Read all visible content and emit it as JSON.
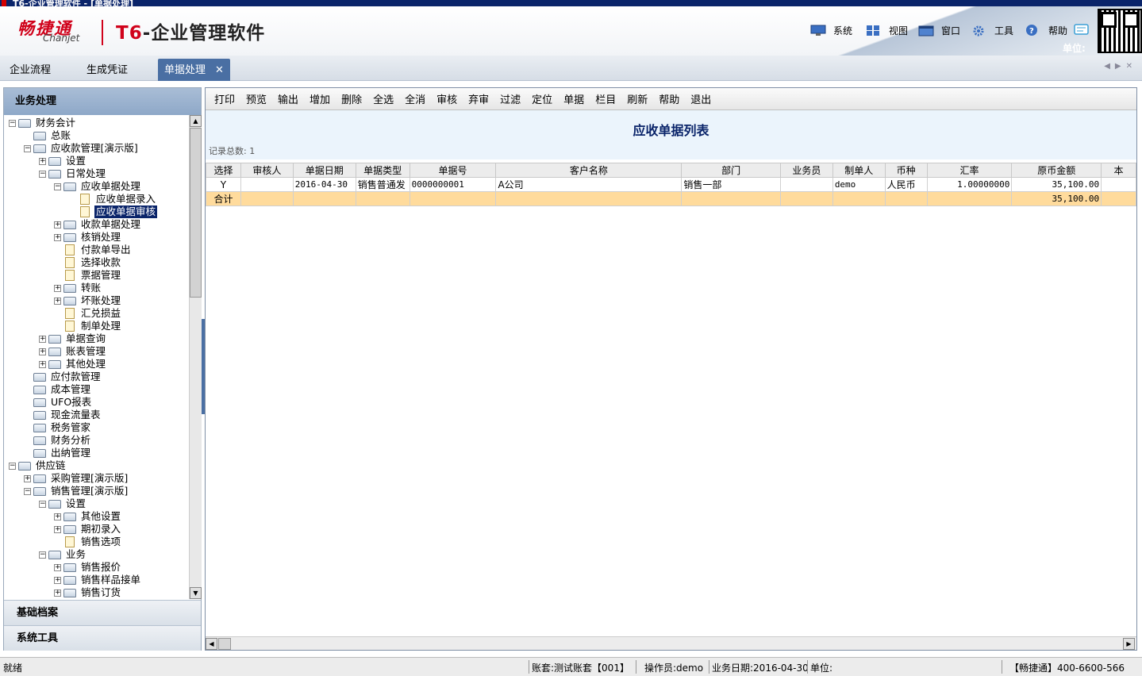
{
  "window": {
    "title": "T6-企业管理软件 - [单据处理]"
  },
  "header": {
    "logo_cn": "畅捷通",
    "logo_en": "Chanjet",
    "product_prefix": "T6",
    "product_name": "-企业管理软件",
    "menus": [
      {
        "label": "系统",
        "icon": "monitor-icon"
      },
      {
        "label": "视图",
        "icon": "grid-view-icon"
      },
      {
        "label": "窗口",
        "icon": "window-icon"
      },
      {
        "label": "工具",
        "icon": "gear-icon"
      },
      {
        "label": "帮助",
        "icon": "help-icon"
      }
    ],
    "unit_label": "单位:",
    "brand_red": "#d0021b"
  },
  "tabs": [
    {
      "label": "企业流程"
    },
    {
      "label": "生成凭证"
    },
    {
      "label": "单据处理",
      "active": true
    }
  ],
  "sidebar": {
    "title": "业务处理",
    "tree": [
      {
        "label": "财务会计",
        "type": "folder",
        "expander": "−"
      },
      {
        "label": "总账",
        "type": "folder",
        "expander": ""
      },
      {
        "label": "应收款管理[演示版]",
        "type": "folder",
        "expander": "−"
      },
      {
        "label": "设置",
        "type": "folder",
        "expander": "+"
      },
      {
        "label": "日常处理",
        "type": "folder",
        "expander": "−"
      },
      {
        "label": "应收单据处理",
        "type": "folder",
        "expander": "−"
      },
      {
        "label": "应收单据录入",
        "type": "doc",
        "expander": ""
      },
      {
        "label": "应收单据审核",
        "type": "doc",
        "expander": "",
        "selected": true
      },
      {
        "label": "收款单据处理",
        "type": "folder",
        "expander": "+"
      },
      {
        "label": "核销处理",
        "type": "folder",
        "expander": "+"
      },
      {
        "label": "付款单导出",
        "type": "doc",
        "expander": ""
      },
      {
        "label": "选择收款",
        "type": "doc",
        "expander": ""
      },
      {
        "label": "票据管理",
        "type": "doc",
        "expander": ""
      },
      {
        "label": "转账",
        "type": "folder",
        "expander": "+"
      },
      {
        "label": "坏账处理",
        "type": "folder",
        "expander": "+"
      },
      {
        "label": "汇兑损益",
        "type": "doc",
        "expander": ""
      },
      {
        "label": "制单处理",
        "type": "doc",
        "expander": ""
      },
      {
        "label": "单据查询",
        "type": "folder",
        "expander": "+"
      },
      {
        "label": "账表管理",
        "type": "folder",
        "expander": "+"
      },
      {
        "label": "其他处理",
        "type": "folder",
        "expander": "+"
      },
      {
        "label": "应付款管理",
        "type": "folder",
        "expander": ""
      },
      {
        "label": "成本管理",
        "type": "folder",
        "expander": ""
      },
      {
        "label": "UFO报表",
        "type": "folder",
        "expander": ""
      },
      {
        "label": "现金流量表",
        "type": "folder",
        "expander": ""
      },
      {
        "label": "税务管家",
        "type": "folder",
        "expander": ""
      },
      {
        "label": "财务分析",
        "type": "folder",
        "expander": ""
      },
      {
        "label": "出纳管理",
        "type": "folder",
        "expander": ""
      },
      {
        "label": "供应链",
        "type": "folder",
        "expander": "−"
      },
      {
        "label": "采购管理[演示版]",
        "type": "folder",
        "expander": "+"
      },
      {
        "label": "销售管理[演示版]",
        "type": "folder",
        "expander": "−"
      },
      {
        "label": "设置",
        "type": "folder",
        "expander": "−"
      },
      {
        "label": "其他设置",
        "type": "folder",
        "expander": "+"
      },
      {
        "label": "期初录入",
        "type": "folder",
        "expander": "+"
      },
      {
        "label": "销售选项",
        "type": "doc",
        "expander": ""
      },
      {
        "label": "业务",
        "type": "folder",
        "expander": "−"
      },
      {
        "label": "销售报价",
        "type": "folder",
        "expander": "+"
      },
      {
        "label": "销售样品接单",
        "type": "folder",
        "expander": "+"
      },
      {
        "label": "销售订货",
        "type": "folder",
        "expander": "+"
      }
    ],
    "sections": [
      {
        "label": "基础档案"
      },
      {
        "label": "系统工具"
      }
    ]
  },
  "toolbar": {
    "buttons": [
      "打印",
      "预览",
      "输出",
      "增加",
      "删除",
      "全选",
      "全消",
      "审核",
      "弃审",
      "过滤",
      "定位",
      "单据",
      "栏目",
      "刷新",
      "帮助",
      "退出"
    ]
  },
  "page": {
    "title": "应收单据列表",
    "record_count": "记录总数: 1"
  },
  "table": {
    "columns": [
      "选择",
      "审核人",
      "单据日期",
      "单据类型",
      "单据号",
      "客户名称",
      "部门",
      "业务员",
      "制单人",
      "币种",
      "汇率",
      "原币金额",
      "本"
    ],
    "rows": [
      [
        "Y",
        "",
        "2016-04-30",
        "销售普通发",
        "0000000001",
        "A公司",
        "销售一部",
        "",
        "demo",
        "人民币",
        "1.00000000",
        "35,100.00",
        ""
      ]
    ],
    "total_row": [
      "合计",
      "",
      "",
      "",
      "",
      "",
      "",
      "",
      "",
      "",
      "",
      "35,100.00",
      ""
    ],
    "total_color": "#ffdb9c"
  },
  "statusbar": {
    "status": "就绪",
    "account": "账套:测试账套【001】",
    "operator": "操作员:demo",
    "business_date": "业务日期:2016-04-30",
    "unit": "单位:",
    "hotline": "【畅捷通】400-6600-566"
  }
}
